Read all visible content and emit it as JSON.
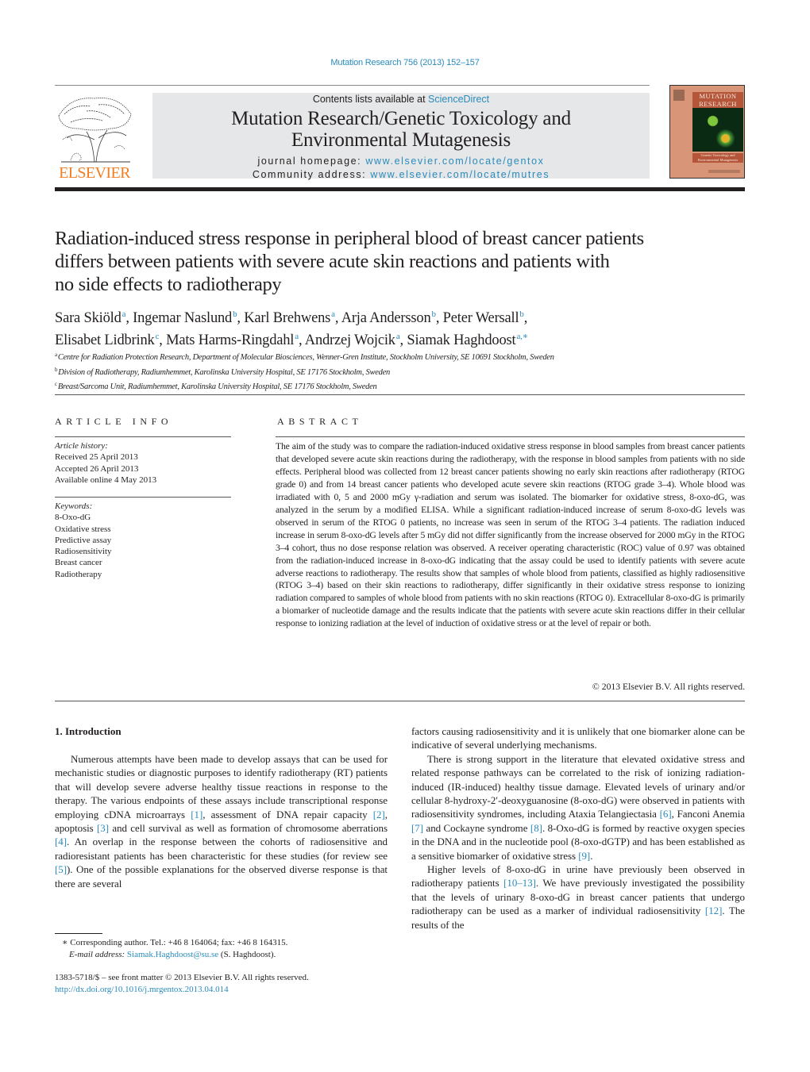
{
  "citation": "Mutation Research 756 (2013) 152–157",
  "header": {
    "publisher_logo_text": "ELSEVIER",
    "contents_prefix": "Contents lists available at ",
    "contents_link": "ScienceDirect",
    "journal_name_line1": "Mutation Research/Genetic Toxicology and",
    "journal_name_line2": "Environmental Mutagenesis",
    "homepage_label": "journal homepage: ",
    "homepage_url": "www.elsevier.com/locate/gentox",
    "community_label": "Community address: ",
    "community_url": "www.elsevier.com/locate/mutres",
    "cover": {
      "title_line1": "MUTATION",
      "title_line2": "RESEARCH",
      "subtitle_line1": "Genetic Toxicology and",
      "subtitle_line2": "Environmental Mutagenesis"
    }
  },
  "article": {
    "title_line1": "Radiation-induced stress response in peripheral blood of breast cancer patients",
    "title_line2": "differs between patients with severe acute skin reactions and patients with",
    "title_line3": "no side effects to radiotherapy",
    "authors": [
      {
        "name": "Sara Skiöld",
        "sup": "a",
        "sep": ", "
      },
      {
        "name": "Ingemar Naslund",
        "sup": "b",
        "sep": ", "
      },
      {
        "name": "Karl Brehwens",
        "sup": "a",
        "sep": ", "
      },
      {
        "name": "Arja Andersson",
        "sup": "b",
        "sep": ", "
      },
      {
        "name": "Peter Wersall",
        "sup": "b",
        "sep": ","
      },
      {
        "name": "Elisabet Lidbrink",
        "sup": "c",
        "sep": ", "
      },
      {
        "name": "Mats Harms-Ringdahl",
        "sup": "a",
        "sep": ", "
      },
      {
        "name": "Andrzej Wojcik",
        "sup": "a",
        "sep": ", "
      },
      {
        "name": "Siamak Haghdoost",
        "sup": "a,∗",
        "sep": ""
      }
    ],
    "affiliations": [
      {
        "key": "a",
        "text": "Centre for Radiation Protection Research, Department of Molecular Biosciences, Wenner-Gren Institute, Stockholm University, SE 10691 Stockholm, Sweden"
      },
      {
        "key": "b",
        "text": "Division of Radiotherapy, Radiumhemmet, Karolinska University Hospital, SE 17176 Stockholm, Sweden"
      },
      {
        "key": "c",
        "text": "Breast/Sarcoma Unit, Radiumhemmet, Karolinska University Hospital, SE 17176 Stockholm, Sweden"
      }
    ]
  },
  "article_info": {
    "heading": "ARTICLE INFO",
    "history_label": "Article history:",
    "received": "Received 25 April 2013",
    "accepted": "Accepted 26 April 2013",
    "online": "Available online 4 May 2013",
    "keywords_label": "Keywords:",
    "keywords": [
      "8-Oxo-dG",
      "Oxidative stress",
      "Predictive assay",
      "Radiosensitivity",
      "Breast cancer",
      "Radiotherapy"
    ]
  },
  "abstract": {
    "heading": "ABSTRACT",
    "text": "The aim of the study was to compare the radiation-induced oxidative stress response in blood samples from breast cancer patients that developed severe acute skin reactions during the radiotherapy, with the response in blood samples from patients with no side effects. Peripheral blood was collected from 12 breast cancer patients showing no early skin reactions after radiotherapy (RTOG grade 0) and from 14 breast cancer patients who developed acute severe skin reactions (RTOG grade 3–4). Whole blood was irradiated with 0, 5 and 2000 mGy γ-radiation and serum was isolated. The biomarker for oxidative stress, 8-oxo-dG, was analyzed in the serum by a modified ELISA. While a significant radiation-induced increase of serum 8-oxo-dG levels was observed in serum of the RTOG 0 patients, no increase was seen in serum of the RTOG 3–4 patients. The radiation induced increase in serum 8-oxo-dG levels after 5 mGy did not differ significantly from the increase observed for 2000 mGy in the RTOG 3–4 cohort, thus no dose response relation was observed. A receiver operating characteristic (ROC) value of 0.97 was obtained from the radiation-induced increase in 8-oxo-dG indicating that the assay could be used to identify patients with severe acute adverse reactions to radiotherapy. The results show that samples of whole blood from patients, classified as highly radiosensitive (RTOG 3–4) based on their skin reactions to radiotherapy, differ significantly in their oxidative stress response to ionizing radiation compared to samples of whole blood from patients with no skin reactions (RTOG 0). Extracellular 8-oxo-dG is primarily a biomarker of nucleotide damage and the results indicate that the patients with severe acute skin reactions differ in their cellular response to ionizing radiation at the level of induction of oxidative stress or at the level of repair or both.",
    "copyright": "© 2013 Elsevier B.V. All rights reserved."
  },
  "introduction": {
    "heading": "1.  Introduction",
    "left_p1": [
      {
        "t": "Numerous attempts have been made to develop assays that can be used for mechanistic studies or diagnostic purposes to identify radiotherapy (RT) patients that will develop severe adverse healthy tissue reactions in response to the therapy. The various endpoints of these assays include transcriptional response employing cDNA microarrays "
      },
      {
        "ref": "[1]"
      },
      {
        "t": ", assessment of DNA repair capacity "
      },
      {
        "ref": "[2]"
      },
      {
        "t": ", apoptosis "
      },
      {
        "ref": "[3]"
      },
      {
        "t": " and cell survival as well as formation of chromosome aberrations "
      },
      {
        "ref": "[4]"
      },
      {
        "t": ". An overlap in the response between the cohorts of radiosensitive and radioresistant patients has been characteristic for these studies (for review see "
      },
      {
        "ref": "[5]"
      },
      {
        "t": "). One of the possible explanations for the observed diverse response is that there are several"
      }
    ],
    "right_p1_cont": [
      {
        "t": "factors causing radiosensitivity and it is unlikely that one biomarker alone can be indicative of several underlying mechanisms."
      }
    ],
    "right_p2": [
      {
        "t": "There is strong support in the literature that elevated oxidative stress and related response pathways can be correlated to the risk of ionizing radiation-induced (IR-induced) healthy tissue damage. Elevated levels of urinary and/or cellular 8-hydroxy-2′-deoxyguanosine (8-oxo-dG) were observed in patients with radiosensitivity syndromes, including Ataxia Telangiectasia "
      },
      {
        "ref": "[6]"
      },
      {
        "t": ", Fanconi Anemia "
      },
      {
        "ref": "[7]"
      },
      {
        "t": " and Cockayne syndrome "
      },
      {
        "ref": "[8]"
      },
      {
        "t": ". 8-Oxo-dG is formed by reactive oxygen species in the DNA and in the nucleotide pool (8-oxo-dGTP) and has been established as a sensitive biomarker of oxidative stress "
      },
      {
        "ref": "[9]"
      },
      {
        "t": "."
      }
    ],
    "right_p3": [
      {
        "t": "Higher levels of 8-oxo-dG in urine have previously been observed in radiotherapy patients "
      },
      {
        "ref": "[10–13]"
      },
      {
        "t": ". We have previously investigated the possibility that the levels of urinary 8-oxo-dG in breast cancer patients that undergo radiotherapy can be used as a marker of individual radiosensitivity "
      },
      {
        "ref": "[12]"
      },
      {
        "t": ". The results of the"
      }
    ]
  },
  "footnotes": {
    "corresponding": "∗  Corresponding author. Tel.: +46 8 164064; fax: +46 8 164315.",
    "email_label": "E-mail address: ",
    "email": "Siamak.Haghdoost@su.se",
    "email_suffix": " (S. Haghdoost).",
    "front_matter": "1383-5718/$ – see front matter © 2013 Elsevier B.V. All rights reserved.",
    "doi": "http://dx.doi.org/10.1016/j.mrgentox.2013.04.014"
  },
  "colors": {
    "link": "#2a8bbd",
    "elsevier_orange": "#f07d22",
    "header_box": "#e6e7e8",
    "text": "#231f20"
  }
}
